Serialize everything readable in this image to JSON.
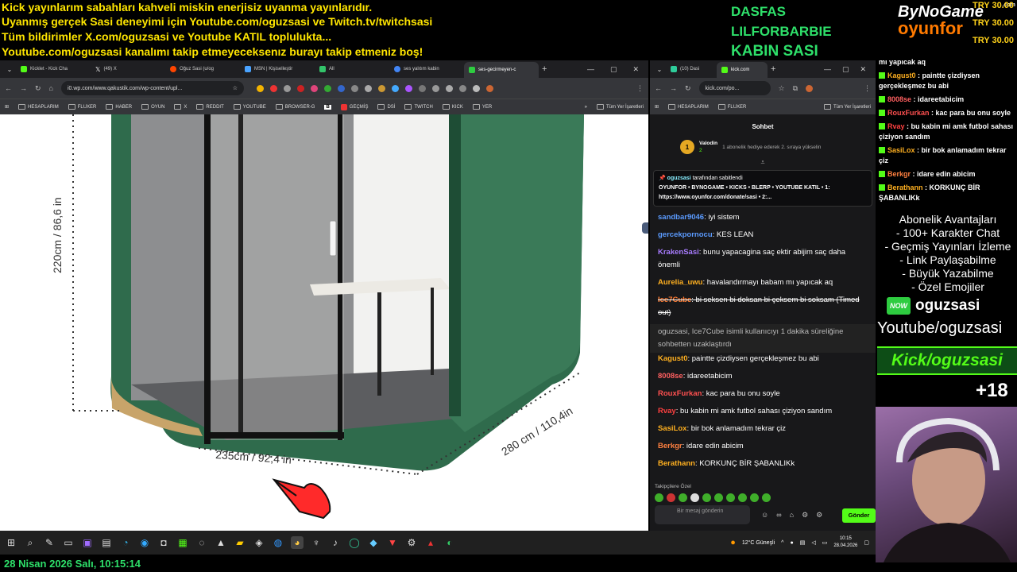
{
  "overlay": {
    "ticker": [
      "Kick yayınlarım sabahları kahveli miskin enerjisiz uyanma yayınlarıdır.",
      "Uyanmış gerçek Sasi deneyimi için Youtube.com/oguzsasi ve Twitch.tv/twitchsasi",
      "Tüm bildirimler X.com/oguzsasi ve Youtube KATIL toplulukta...",
      "Youtube.com/oguzsasi kanalımı takip etmeyeceksenız burayı takip etmeniz boş!"
    ],
    "names": [
      "DASFAS",
      "LILFORBARBIE",
      "KABIN SASI"
    ],
    "logo_top": "ByNoGame",
    "logo_com": ".com",
    "logo_bottom": "oyunfor",
    "donations": [
      "TRY 30.00",
      "TRY 30.00",
      "TRY 30.00"
    ],
    "perks": [
      "Abonelik Avantajları",
      "- 100+ Karakter Chat",
      "- Geçmiş Yayınları İzleme",
      "- Link Paylaşabilme",
      "- Büyük Yazabilme",
      "- Özel Emojiler"
    ],
    "now_label": "NOW",
    "now_name": "oguzsasi",
    "youtube": "Youtube/oguzsasi",
    "kick": "Kick/oguzsasi",
    "age": "+18",
    "date": "28 Nisan 2026 Salı, 10:15:14",
    "chat": [
      {
        "user": "",
        "text": "mı yapıcak aq",
        "color": "#ffffff"
      },
      {
        "user": "Kagust0",
        "text": "paintte çizdiysen gerçekleşmez bu abi",
        "color": "#ffb020"
      },
      {
        "user": "8008se",
        "text": "idareetabicim",
        "color": "#ff6060"
      },
      {
        "user": "RouxFurkan",
        "text": "kac para bu onu soyle",
        "color": "#ff5050"
      },
      {
        "user": "Rvay",
        "text": "bu kabin mi amk futbol sahası çiziyon sandım",
        "color": "#ff4040"
      },
      {
        "user": "SasiLox",
        "text": "bir bok anlamadım tekrar çiz",
        "color": "#ffb020"
      },
      {
        "user": "Berkgr",
        "text": "idare edin abicim",
        "color": "#ff8040"
      },
      {
        "user": "Berathann",
        "text": "KORKUNÇ BİR ŞABANLIKk",
        "color": "#ffb020"
      }
    ]
  },
  "browser": {
    "tabs": [
      "Kicklet - Kick Cha",
      "(49) X",
      "Oğuz Sasi (u/og",
      "MSN | Kişiselleştir",
      "All",
      "ses yalıtım kabin",
      "ses-gecirmeyen-c"
    ],
    "url": "i0.wp.com/www.qakustik.com/wp-content/upl...",
    "bookmarks": [
      "HESAPLARIM",
      "FLUXER",
      "HABER",
      "OYUN",
      "X",
      "REDDIT",
      "YOUTUBE",
      "BROWSER-G",
      "B",
      "GEÇMİŞ",
      "DSİ",
      "TWITCH",
      "KICK",
      "YER"
    ],
    "all_bookmarks": "Tüm Yer İşaretleri",
    "dims": {
      "height": "220cm / 86,6 in",
      "width": "235cm / 92,4 in",
      "depth": "280 cm / 110,4in"
    }
  },
  "kick": {
    "tabs": [
      "(10) Dasi",
      "kick.com"
    ],
    "url": "kick.com/po...",
    "bookmarks": [
      "HESAPLARIM",
      "FLUXER"
    ],
    "all_bookmarks": "Tüm Yer İşaretleri",
    "title": "Sohbet",
    "gift_user": "Valodin",
    "gift_rank": "1",
    "gift_sub": "2",
    "gift_text": "1 abonelik hediye ederek 2. sıraya yükselin",
    "pinned_by": "oguzsasi",
    "pinned_suffix": "tarafından sabitlendi",
    "pinned_text": "OYUNFOR • BYNOGAME • KICKS • BLERP • YOUTUBE KATIL • 1: https://www.oyunfor.com/donate/sasi • 2:...",
    "messages": [
      {
        "user": "sandbar9046",
        "text": "iyi sistem",
        "color": "#5b9bff"
      },
      {
        "user": "gercekpornocu",
        "text": "KES LEAN",
        "color": "#5b9bff"
      },
      {
        "user": "KrakenSasi",
        "text": "bunu yapacagina saç ektir abijim saç daha önemli",
        "color": "#a87cff"
      },
      {
        "user": "Aurelia_uwu",
        "text": "havalandırmayı babam mı yapıcak aq",
        "color": "#ffb020"
      },
      {
        "user": "Ice7Cube",
        "text": "bi seksen bi doksan bi çeksem bi soksam (Timed out)",
        "color": "#ff7a30"
      },
      {
        "user": "",
        "text": "oguzsasi, Ice7Cube isimli kullanıcıyı 1 dakika süreliğine sohbetten uzaklaştırdı",
        "color": "#bbbbbb"
      },
      {
        "user": "Kagust0",
        "text": "paintte çizdiysen gerçekleşmez bu abi",
        "color": "#ffb020"
      },
      {
        "user": "8008se",
        "text": "idareetabicim",
        "color": "#ff6060"
      },
      {
        "user": "RouxFurkan",
        "text": "kac para bu onu soyle",
        "color": "#ff5050"
      },
      {
        "user": "Rvay",
        "text": "bu kabin mi amk futbol sahası çiziyon sandım",
        "color": "#ff4040"
      },
      {
        "user": "SasiLox",
        "text": "bir bok anlamadım tekrar çiz",
        "color": "#ffb020"
      },
      {
        "user": "Berkgr",
        "text": "idare edin abicim",
        "color": "#ff8040"
      },
      {
        "user": "Berathann",
        "text": "KORKUNÇ BİR ŞABANLIKk",
        "color": "#ffb020"
      }
    ],
    "followers_only": "Takipçilere Özel",
    "input_placeholder": "Bir mesaj gönderin",
    "send": "Gönder"
  },
  "taskbar": {
    "weather": "12°C  Güneşli",
    "time": "10:15",
    "date": "28.04.2026"
  }
}
